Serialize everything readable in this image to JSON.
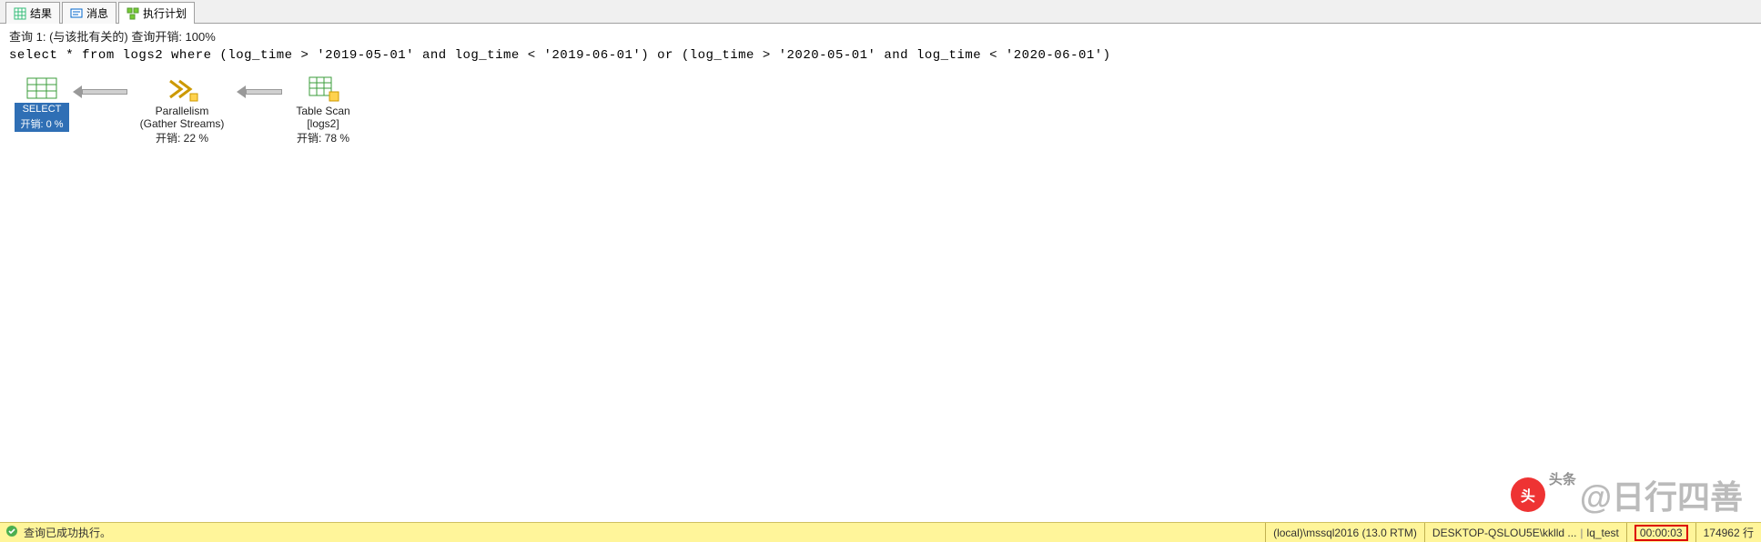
{
  "tabs": {
    "results": "结果",
    "messages": "消息",
    "plan": "执行计划"
  },
  "header": {
    "query_label": "查询 1: (与该批有关的) 查询开销: 100%",
    "sql": "select * from logs2 where (log_time > '2019-05-01' and log_time < '2019-06-01') or (log_time > '2020-05-01' and log_time < '2020-06-01')"
  },
  "plan": {
    "select": {
      "label": "SELECT",
      "cost": "开销: 0 %"
    },
    "parallelism": {
      "title": "Parallelism",
      "sub": "(Gather Streams)",
      "cost": "开销: 22 %"
    },
    "tablescan": {
      "title": "Table Scan",
      "sub": "[logs2]",
      "cost": "开销: 78 %"
    }
  },
  "status": {
    "ok": "查询已成功执行。",
    "server": "(local)\\mssql2016 (13.0 RTM)",
    "user": "DESKTOP-QSLOU5E\\kklld ...",
    "db": "lq_test",
    "time": "00:00:03",
    "rows": "174962 行"
  },
  "watermark": {
    "small": "头条",
    "big": "@日行四善"
  }
}
